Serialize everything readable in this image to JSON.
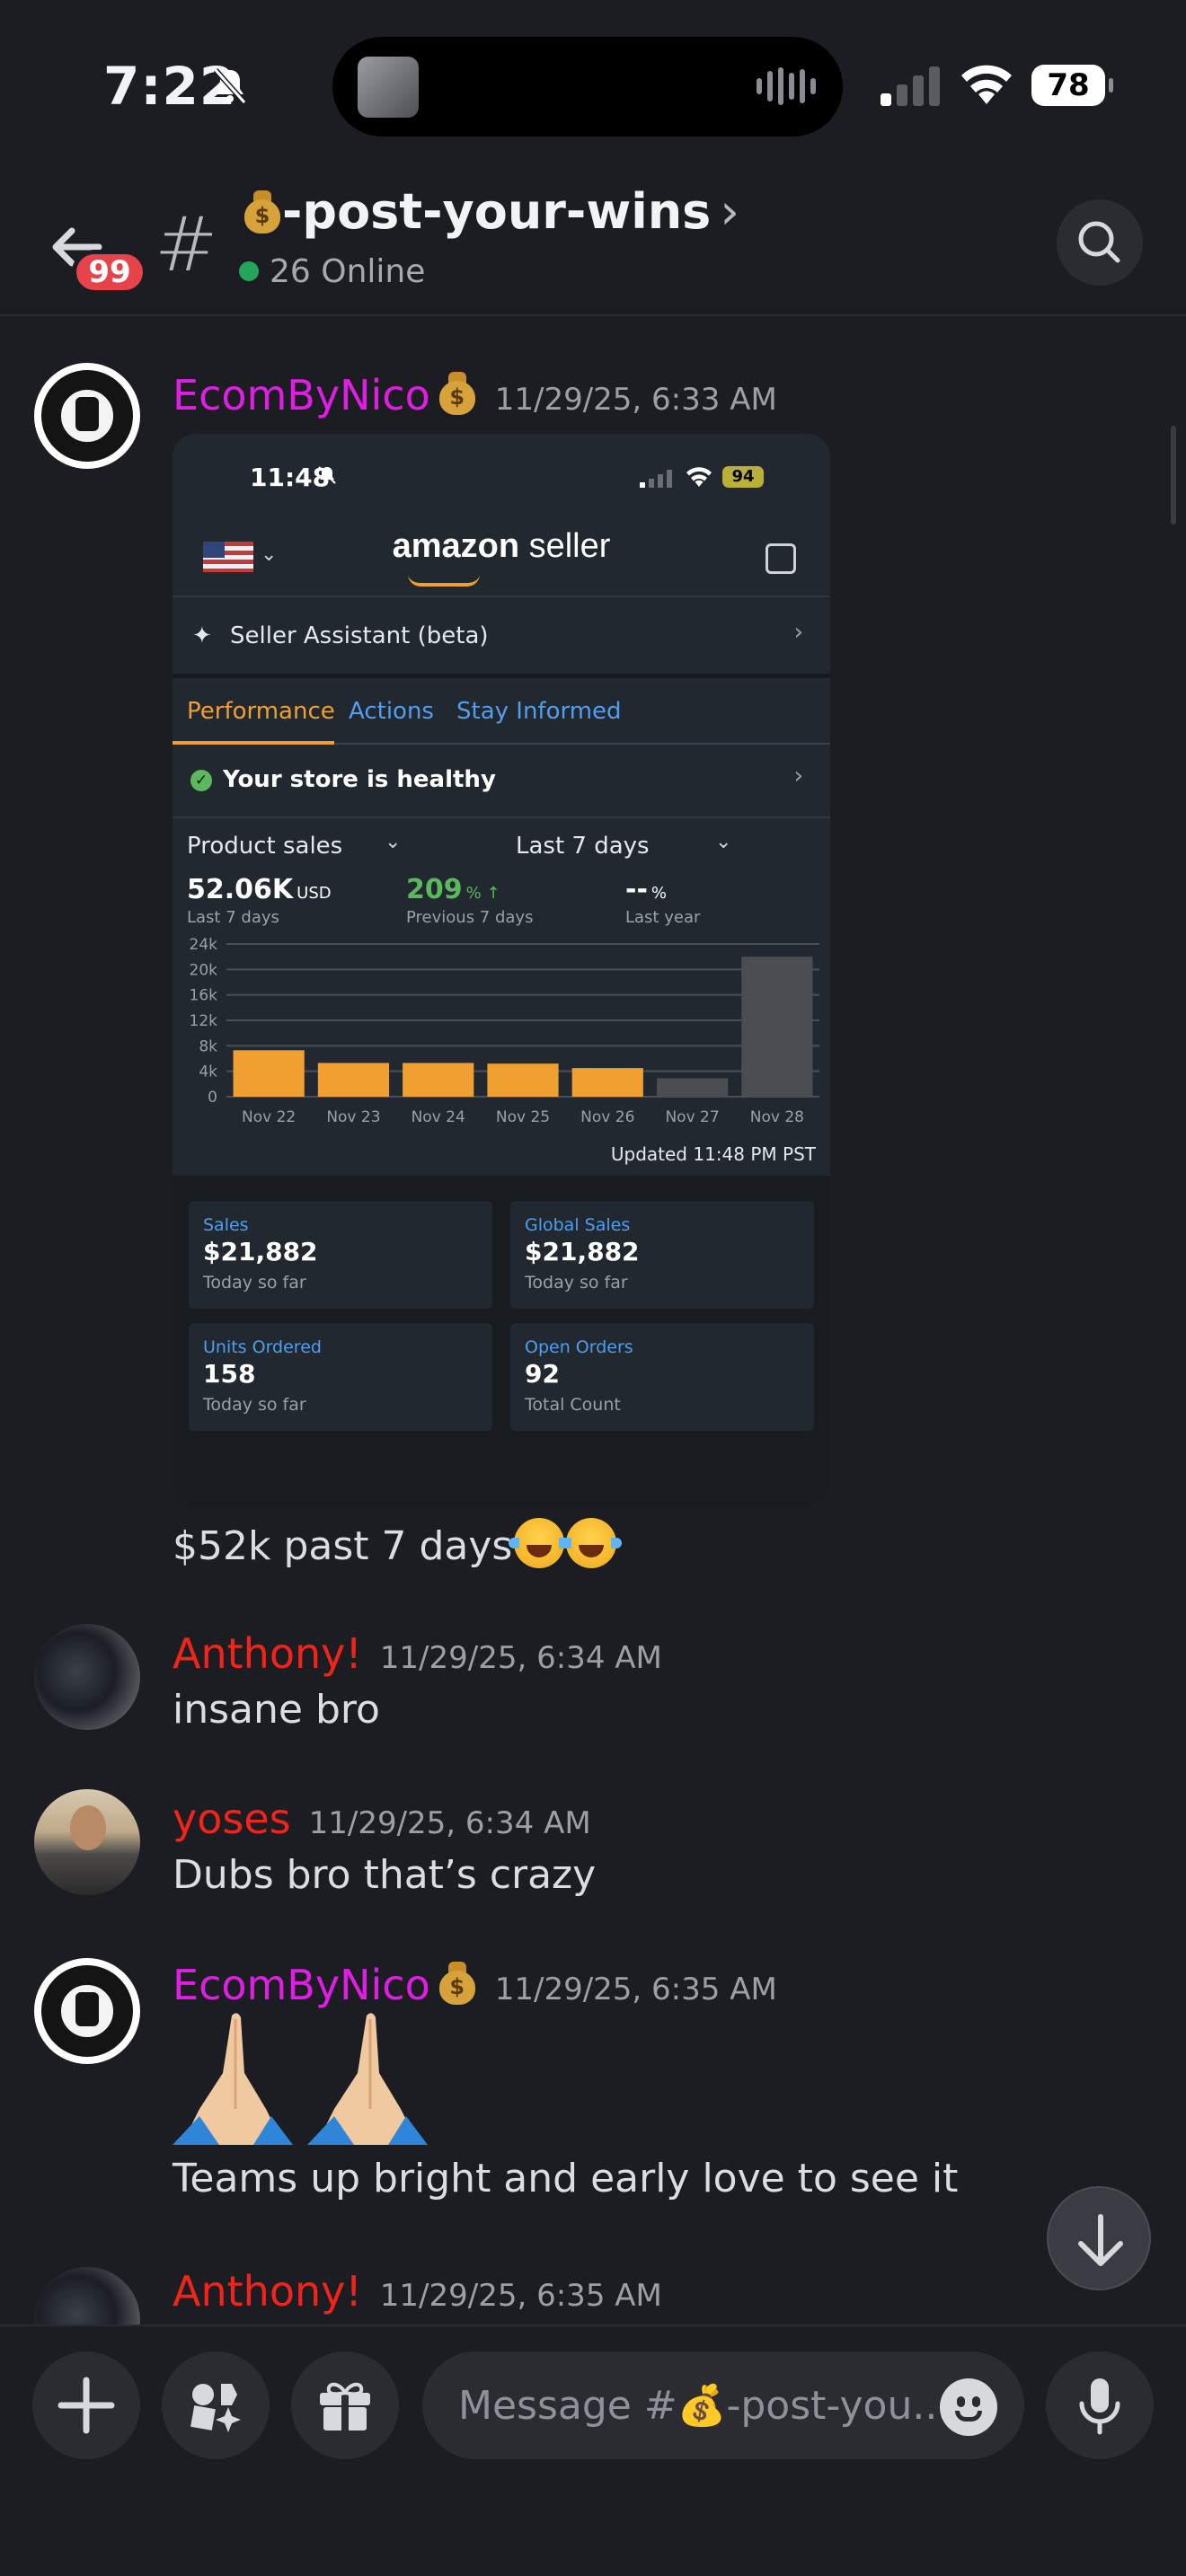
{
  "status_bar": {
    "time": "7:22",
    "battery": "78"
  },
  "header": {
    "unread_badge": "99",
    "channel_name": "-post-your-wins",
    "online": "26 Online"
  },
  "messages": [
    {
      "author": "EcomByNico",
      "timestamp": "11/29/25, 6:33 AM",
      "text": "$52k past 7 days",
      "embed": {
        "time": "11:48",
        "battery": "94",
        "logo_bold": "amazon",
        "logo_rest": " seller",
        "assistant": "Seller Assistant (beta)",
        "tabs": [
          "Performance",
          "Actions",
          "Stay Informed"
        ],
        "health": "Your store is healthy",
        "metric_select": "Product sales",
        "range_select": "Last 7 days",
        "kpis": [
          {
            "value": "52.06K",
            "unit": "USD",
            "label": "Last 7 days"
          },
          {
            "value": "209",
            "unit": "% ↑",
            "label": "Previous 7 days"
          },
          {
            "value": "--",
            "unit": "%",
            "label": "Last year"
          }
        ],
        "updated": "Updated 11:48 PM PST",
        "cards": [
          {
            "head": "Sales",
            "value": "$21,882",
            "sub": "Today so far"
          },
          {
            "head": "Global Sales",
            "value": "$21,882",
            "sub": "Today so far"
          },
          {
            "head": "Units Ordered",
            "value": "158",
            "sub": "Today so far"
          },
          {
            "head": "Open Orders",
            "value": "92",
            "sub": "Total Count"
          }
        ]
      }
    },
    {
      "author": "Anthony!",
      "timestamp": "11/29/25, 6:34 AM",
      "text": "insane bro"
    },
    {
      "author": "yoses",
      "timestamp": "11/29/25, 6:34 AM",
      "text": "Dubs bro that’s crazy"
    },
    {
      "author": "EcomByNico",
      "timestamp": "11/29/25, 6:35 AM",
      "text": "Teams up bright and early love to see it"
    },
    {
      "author": "Anthony!",
      "timestamp": "11/29/25, 6:35 AM",
      "text": ""
    }
  ],
  "composer": {
    "placeholder": "Message #💰-post-you..."
  },
  "colors": {
    "accent_purple": "#e11de5",
    "accent_red": "#f2241a",
    "online_green": "#23a55a",
    "bar_orange": "#f0a030",
    "bar_gray": "#4a4d52"
  },
  "chart_data": {
    "type": "bar",
    "categories": [
      "Nov 22",
      "Nov 23",
      "Nov 24",
      "Nov 25",
      "Nov 26",
      "Nov 27",
      "Nov 28"
    ],
    "values": [
      7300,
      5300,
      5300,
      5200,
      4500,
      2900,
      22000
    ],
    "highlight": [
      true,
      true,
      true,
      true,
      true,
      false,
      false
    ],
    "ylim": [
      0,
      24000
    ],
    "yticks": [
      "0",
      "4k",
      "8k",
      "12k",
      "16k",
      "20k",
      "24k"
    ],
    "grid": true
  }
}
